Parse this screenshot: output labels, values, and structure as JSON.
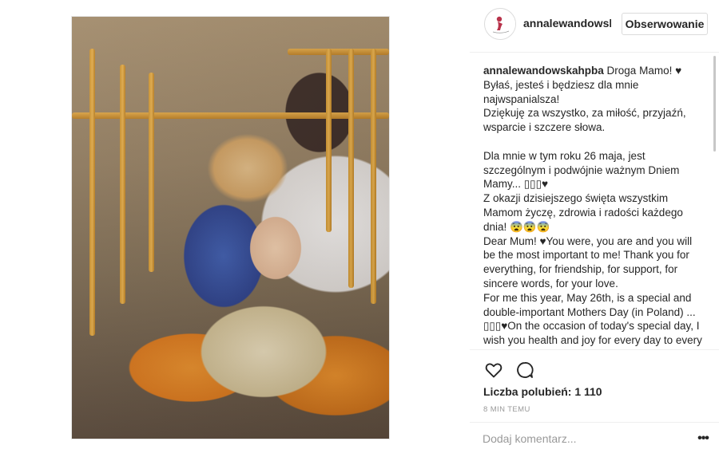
{
  "post": {
    "username": "annalewandowsk",
    "follow_label": "Obserwowanie",
    "caption_user": "annalewandowskahpba",
    "caption_text": " Droga Mamo! ♥\nByłaś, jesteś i będziesz dla mnie najwspanialsza!\nDziękuję za wszystko, za miłość, przyjaźń, wsparcie i szczere słowa.\n\nDla mnie w tym roku 26 maja, jest szczególnym i podwójnie ważnym Dniem Mamy... ▯▯▯♥\nZ okazji dzisiejszego święta wszystkim Mamom życzę, zdrowia i radości każdego dnia! 😨😨😨\nDear Mum! ♥You were, you are and you will be the most important to me! Thank you for everything, for friendship, for support, for sincere words, for your love.\nFor me this year, May 26th, is a special and double-important Mothers Day (in Poland) ... ▯▯▯♥On the occasion of today's special day, I wish you health and joy for every day to every mother!",
    "likes_label": "Liczba polubień: 1 110",
    "timestamp": "8 MIN TEMU",
    "comment_placeholder": "Dodaj komentarz...",
    "more_label": "•••"
  },
  "icons": {
    "like": "heart-icon",
    "comment": "comment-bubble-icon"
  }
}
